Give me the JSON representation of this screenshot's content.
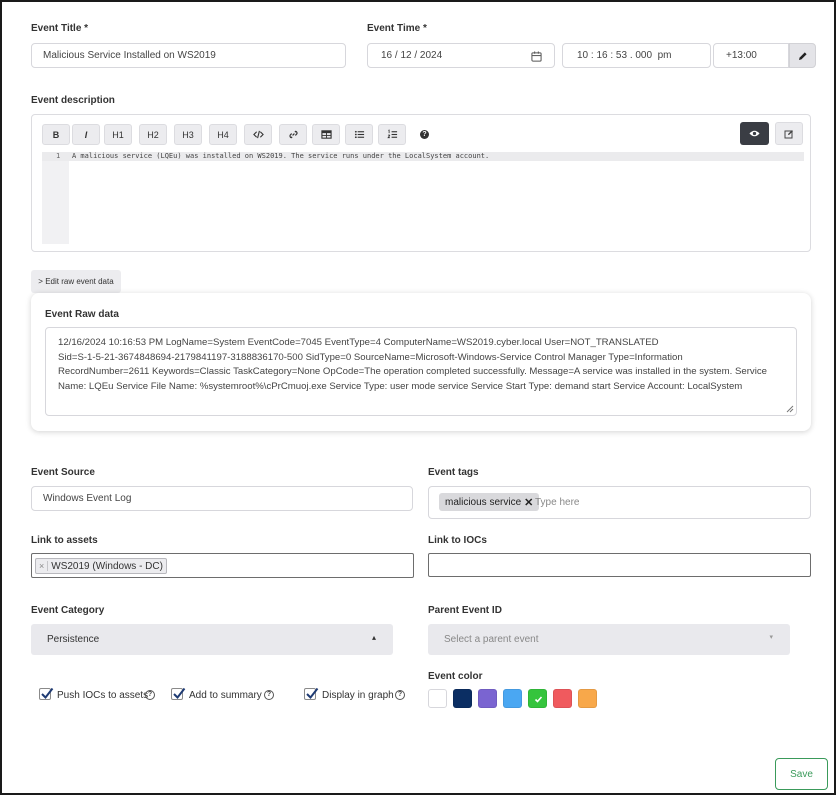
{
  "event_title": {
    "label": "Event Title *",
    "value": "Malicious Service Installed on WS2019"
  },
  "event_time": {
    "label": "Event Time *",
    "date": "16 / 12 / 2024",
    "time": "10 : 16 : 53 . 000  pm",
    "timezone": "+13:00"
  },
  "description": {
    "label": "Event description",
    "toolbar": {
      "bold": "B",
      "italic": "I",
      "h1": "H1",
      "h2": "H2",
      "h3": "H3",
      "h4": "H4"
    },
    "line_number": "1",
    "text": "A malicious service (LQEu) was installed on WS2019. The service runs under the LocalSystem account."
  },
  "raw_toggle": {
    "label": "> Edit raw event data"
  },
  "raw_data": {
    "label": "Event Raw data",
    "lines": [
      "12/16/2024 10:16:53 PM LogName=System EventCode=7045 EventType=4 ComputerName=WS2019.cyber.local User=NOT_TRANSLATED",
      "Sid=S-1-5-21-3674848694-2179841197-3188836170-500 SidType=0 SourceName=Microsoft-Windows-Service Control Manager Type=Information",
      "RecordNumber=2611 Keywords=Classic TaskCategory=None OpCode=The operation completed successfully. Message=A service was installed in the system. Service",
      "Name: LQEu Service File Name: %systemroot%\\cPrCmuoj.exe Service Type: user mode service Service Start Type: demand start Service Account: LocalSystem"
    ]
  },
  "event_source": {
    "label": "Event Source",
    "value": "Windows Event Log"
  },
  "event_tags": {
    "label": "Event tags",
    "tag": "malicious service",
    "placeholder": "Type here"
  },
  "link_assets": {
    "label": "Link to assets",
    "asset": "WS2019 (Windows - DC)",
    "remove": "×"
  },
  "link_iocs": {
    "label": "Link to IOCs",
    "value": ""
  },
  "event_category": {
    "label": "Event Category",
    "value": "Persistence"
  },
  "parent_event": {
    "label": "Parent Event ID",
    "placeholder": "Select a parent event"
  },
  "options": {
    "push_iocs": "Push IOCs to assets",
    "add_summary": "Add to summary",
    "display_graph": "Display in graph",
    "help": "?"
  },
  "event_color": {
    "label": "Event color",
    "colors": [
      "#ffffff",
      "#0b2e63",
      "#7a64d1",
      "#4aa7f2",
      "#35c43d",
      "#f05a5e",
      "#f8a84a"
    ],
    "selected_index": 4
  },
  "save": {
    "label": "Save"
  },
  "accent": "#3a9a5a"
}
